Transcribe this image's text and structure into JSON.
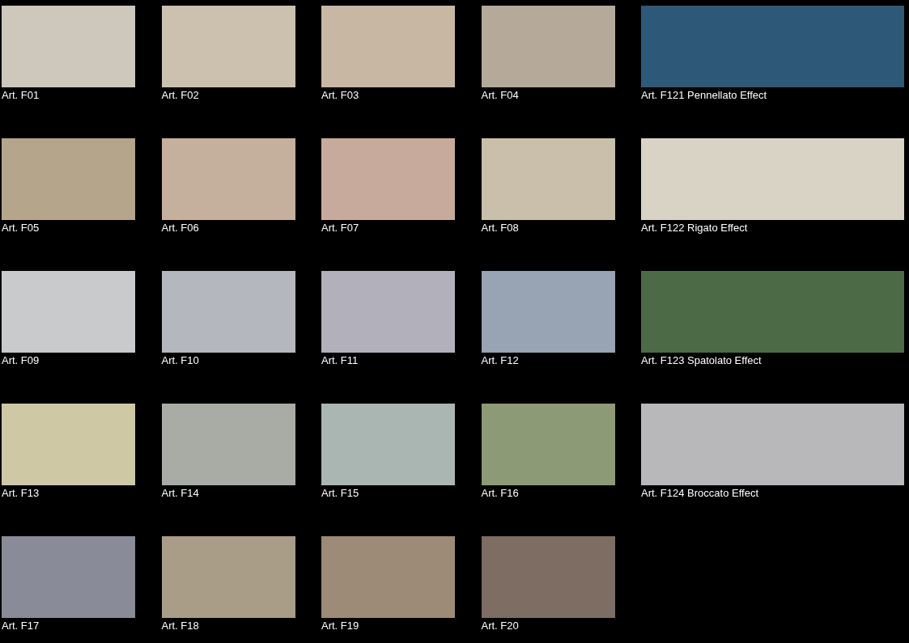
{
  "rows": [
    {
      "swatches": [
        {
          "label": "Art. F01",
          "color": "#cdc8bb"
        },
        {
          "label": "Art. F02",
          "color": "#cbc1ae"
        },
        {
          "label": "Art. F03",
          "color": "#c8b8a3"
        },
        {
          "label": "Art. F04",
          "color": "#b5aa99"
        },
        {
          "label": "Art. F121 Pennellato Effect",
          "color": "#2e5878"
        }
      ]
    },
    {
      "swatches": [
        {
          "label": "Art. F05",
          "color": "#b5a58a"
        },
        {
          "label": "Art. F06",
          "color": "#c4b09c"
        },
        {
          "label": "Art. F07",
          "color": "#c8aa9c"
        },
        {
          "label": "Art. F08",
          "color": "#c9bfab"
        },
        {
          "label": "Art. F122 Rigato Effect",
          "color": "#d8d3c4"
        }
      ]
    },
    {
      "swatches": [
        {
          "label": "Art. F09",
          "color": "#c9cacb"
        },
        {
          "label": "Art. F10",
          "color": "#b4b8be"
        },
        {
          "label": "Art. F11",
          "color": "#b2b0bb"
        },
        {
          "label": "Art. F12",
          "color": "#98a3b3"
        },
        {
          "label": "Art. F123 Spatolato Effect",
          "color": "#4d6a47"
        }
      ]
    },
    {
      "swatches": [
        {
          "label": "Art. F13",
          "color": "#cfc8a4"
        },
        {
          "label": "Art. F14",
          "color": "#a9aba5"
        },
        {
          "label": "Art. F15",
          "color": "#a9b6b1"
        },
        {
          "label": "Art. F16",
          "color": "#8c9b75"
        },
        {
          "label": "Art. F124 Broccato Effect",
          "color": "#b8b8ba"
        }
      ]
    },
    {
      "swatches": [
        {
          "label": "Art. F17",
          "color": "#8a8b98"
        },
        {
          "label": "Art. F18",
          "color": "#a99d88"
        },
        {
          "label": "Art. F19",
          "color": "#9d8b77"
        },
        {
          "label": "Art. F20",
          "color": "#7d6d62"
        }
      ]
    }
  ]
}
